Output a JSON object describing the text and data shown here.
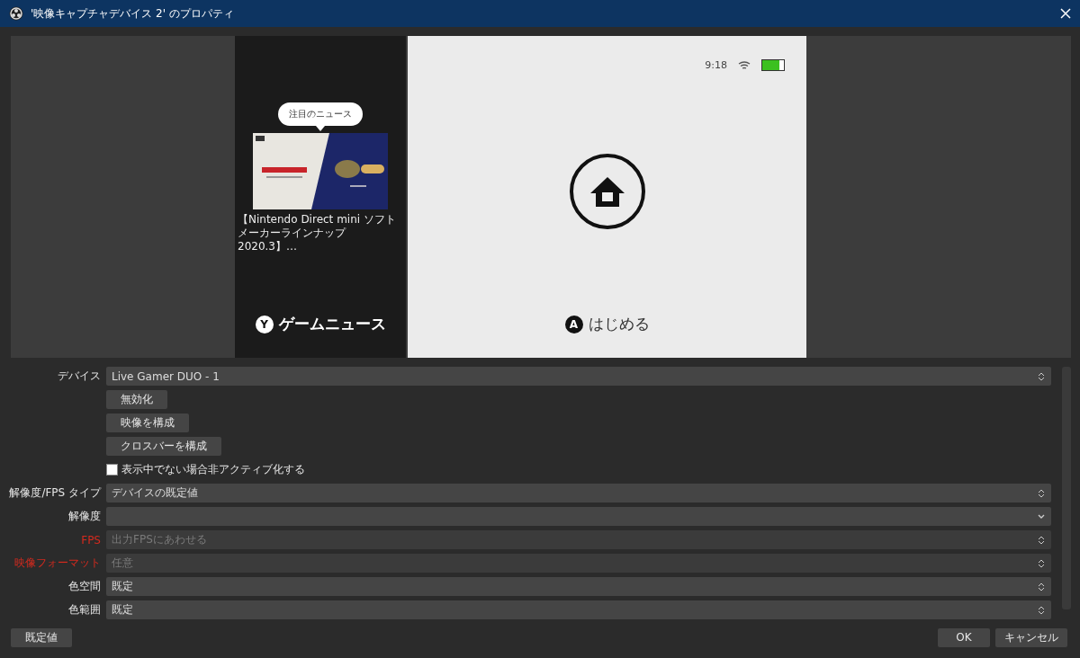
{
  "window": {
    "title": "'映像キャプチャデバイス 2' のプロパティ"
  },
  "preview": {
    "news_bubble": "注目のニュース",
    "news_caption": "【Nintendo Direct mini ソフトメーカーラインナップ 2020.3】…",
    "left_button": "Y",
    "left_label": "ゲームニュース",
    "right_button": "A",
    "right_label": "はじめる",
    "time": "9:18",
    "battery": {
      "level": 0.8
    }
  },
  "device": {
    "label": "デバイス",
    "value": "Live Gamer DUO - 1"
  },
  "device_buttons": [
    "無効化",
    "映像を構成",
    "クロスバーを構成"
  ],
  "deactivate_checkbox": {
    "label": "表示中でない場合非アクティブ化する",
    "checked": false
  },
  "fields": [
    {
      "label": "解像度/FPS タイプ",
      "value": "デバイスの既定値",
      "kind": "spin",
      "disabled": false
    },
    {
      "label": "解像度",
      "kind": "dropdown",
      "disabled": false
    },
    {
      "label": "FPS",
      "value": "出力FPSにあわせる",
      "kind": "spin",
      "disabled": true
    },
    {
      "label": "映像フォーマット",
      "value": "任意",
      "kind": "spin",
      "disabled": true
    },
    {
      "label": "色空間",
      "value": "既定",
      "kind": "spin",
      "disabled": false
    },
    {
      "label": "色範囲",
      "value": "既定",
      "kind": "spin",
      "disabled": false
    }
  ],
  "footer": {
    "defaults_button": "既定値",
    "ok_button": "OK",
    "cancel_button": "キャンセル"
  }
}
